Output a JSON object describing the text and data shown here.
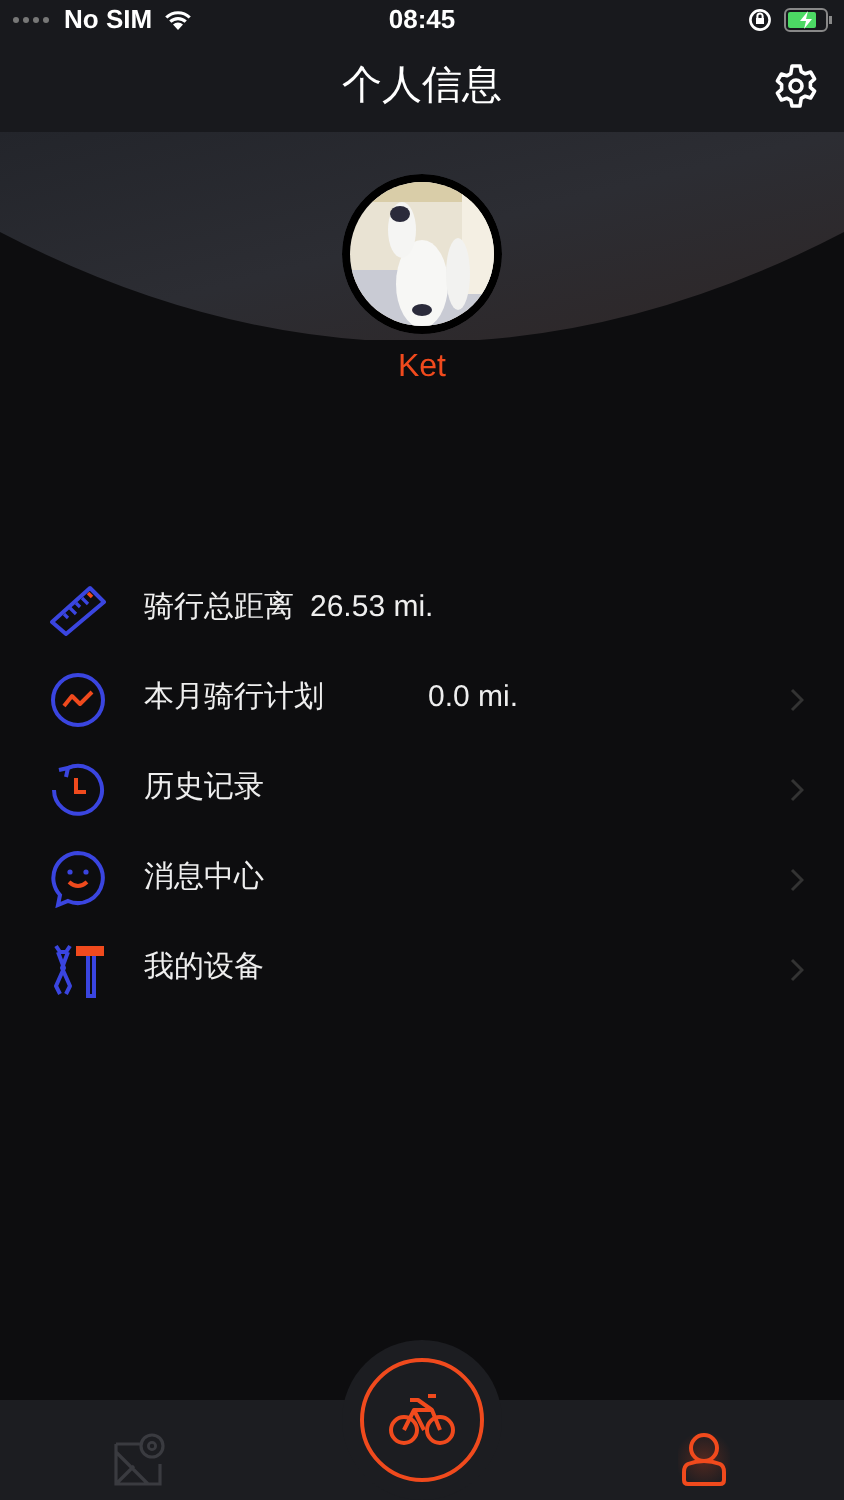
{
  "status_bar": {
    "carrier": "No SIM",
    "time": "08:45"
  },
  "header": {
    "title": "个人信息"
  },
  "profile": {
    "name": "Ket"
  },
  "menu": [
    {
      "kind": "ruler",
      "label": "骑行总距离",
      "value": "26.53 mi.",
      "chevron": false
    },
    {
      "kind": "plan",
      "label": "本月骑行计划",
      "value": "0.0 mi.",
      "chevron": true
    },
    {
      "kind": "history",
      "label": "历史记录",
      "chevron": true
    },
    {
      "kind": "messages",
      "label": "消息中心",
      "chevron": true
    },
    {
      "kind": "devices",
      "label": "我的设备",
      "chevron": true
    }
  ],
  "tab_bar": [
    {
      "kind": "map",
      "selected": false
    },
    {
      "kind": "ride",
      "selected": true
    },
    {
      "kind": "profile",
      "selected": true
    }
  ]
}
